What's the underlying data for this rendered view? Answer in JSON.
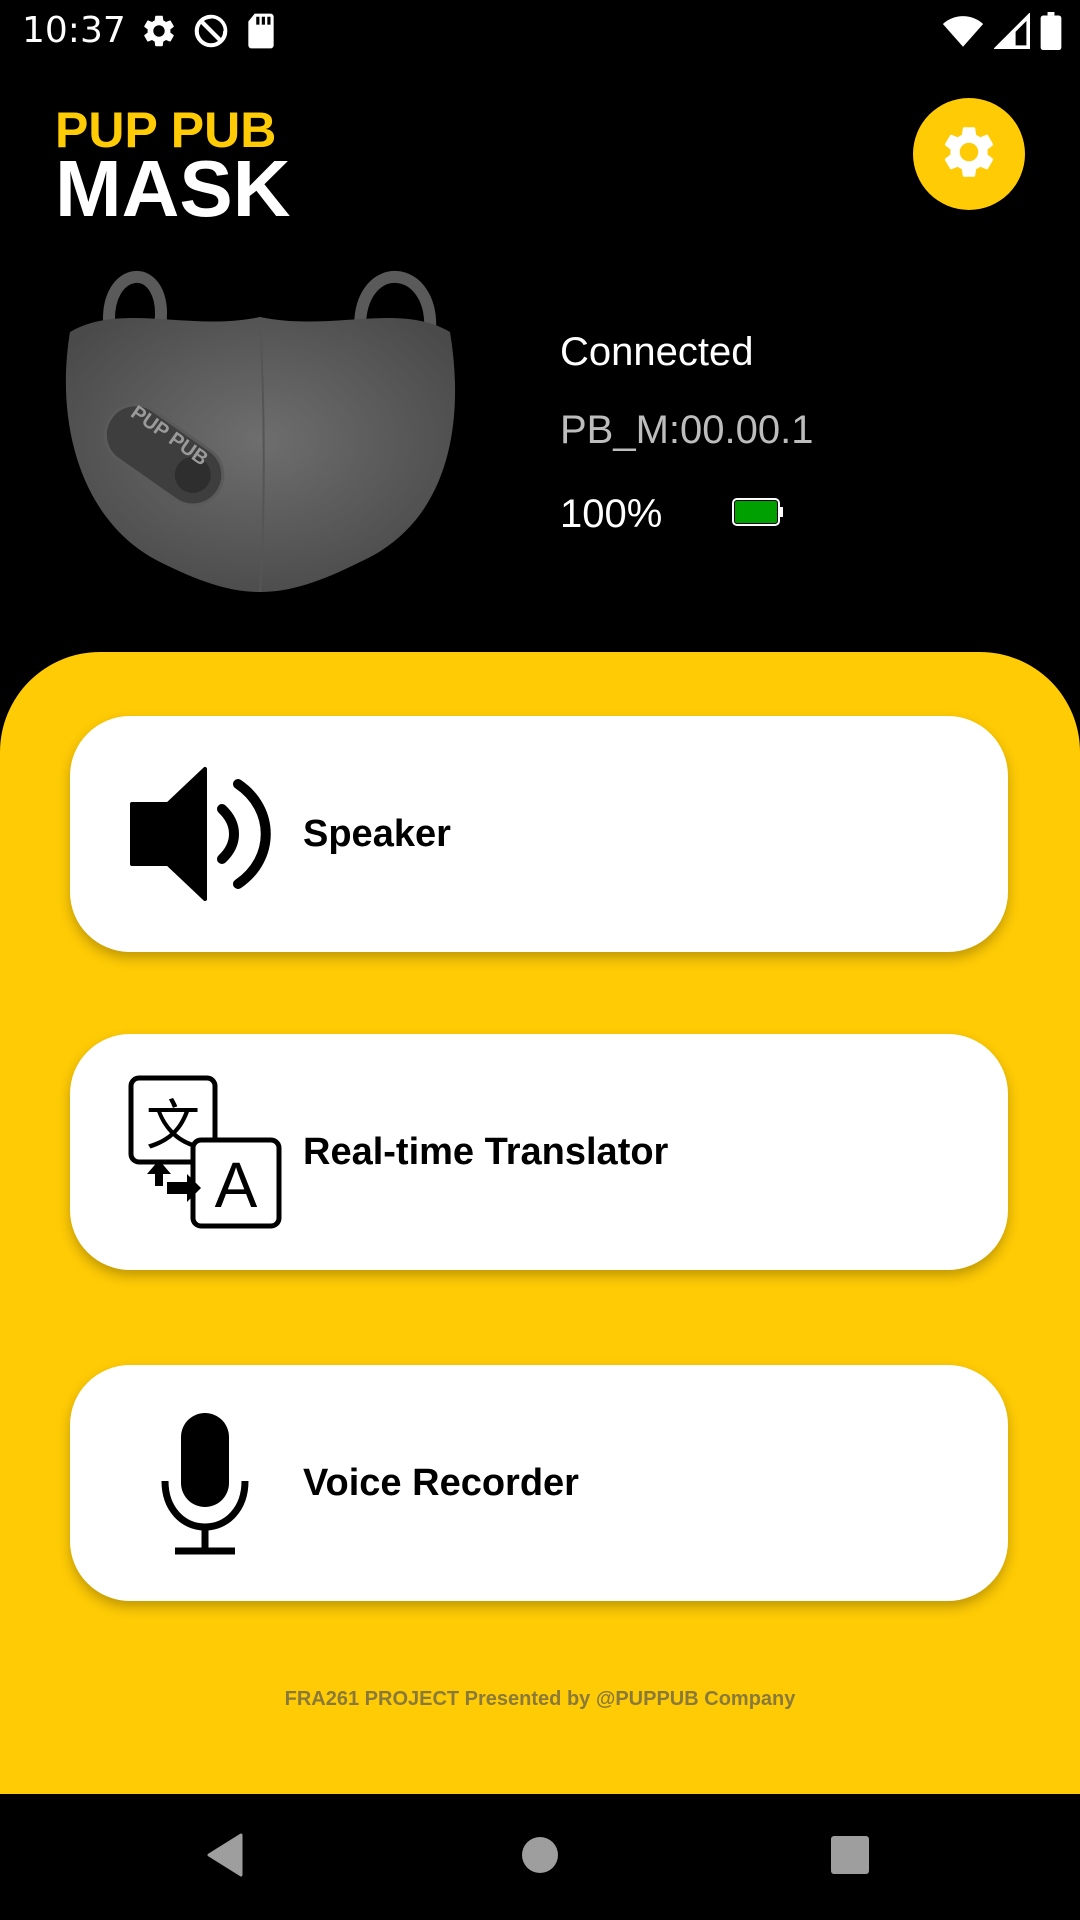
{
  "status_bar": {
    "time": "10:37",
    "left_icons": [
      "gear-icon",
      "sync-icon",
      "sd-card-icon"
    ],
    "right_icons": [
      "wifi-icon",
      "cell-signal-icon",
      "battery-full-icon"
    ]
  },
  "header": {
    "brand_top": "PUP PUB",
    "brand_bottom": "MASK",
    "settings_icon": "gear-icon",
    "brand_color": "#FFCB05"
  },
  "device": {
    "image_text": "PUP PUB",
    "connection_status": "Connected",
    "device_id": "PB_M:00.00.1",
    "battery_percent": "100%",
    "battery_level": 1.0,
    "battery_color": "#00A000"
  },
  "menu": {
    "items": [
      {
        "label": "Speaker",
        "icon": "speaker-icon"
      },
      {
        "label": "Real-time Translator",
        "icon": "translate-icon"
      },
      {
        "label": "Voice Recorder",
        "icon": "microphone-icon"
      }
    ]
  },
  "footer": {
    "text": "FRA261 PROJECT Presented by @PUPPUB Company"
  },
  "nav_bar": {
    "back_icon": "back-triangle-icon",
    "home_icon": "home-circle-icon",
    "recent_icon": "recent-square-icon"
  }
}
